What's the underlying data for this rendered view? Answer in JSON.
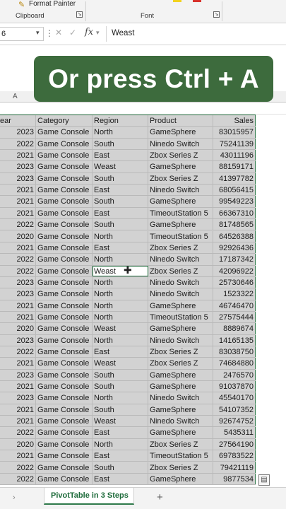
{
  "ribbon": {
    "format_painter_label": "Format Painter",
    "groups": [
      {
        "label": "Clipboard"
      },
      {
        "label": "Font"
      }
    ]
  },
  "formula_bar": {
    "namebox_value": "6",
    "fx_label": "fx",
    "value": "Weast"
  },
  "caption": "Or press Ctrl + A",
  "columns": {
    "letters": [
      "A"
    ]
  },
  "table": {
    "headers": [
      "ear",
      "Category",
      "Region",
      "Product",
      "Sales"
    ],
    "rows": [
      [
        "2023",
        "Game Console",
        "North",
        "GameSphere",
        "83015957"
      ],
      [
        "2022",
        "Game Console",
        "South",
        "Ninedo Switch",
        "75241139"
      ],
      [
        "2021",
        "Game Console",
        "East",
        "Zbox Series Z",
        "43011196"
      ],
      [
        "2023",
        "Game Console",
        "Weast",
        "GameSphere",
        "88159171"
      ],
      [
        "2023",
        "Game Console",
        "South",
        "Zbox Series Z",
        "41397782"
      ],
      [
        "2021",
        "Game Console",
        "East",
        "Ninedo Switch",
        "68056415"
      ],
      [
        "2021",
        "Game Console",
        "South",
        "GameSphere",
        "99549223"
      ],
      [
        "2021",
        "Game Console",
        "East",
        "TimeoutStation 5",
        "66367310"
      ],
      [
        "2022",
        "Game Console",
        "South",
        "GameSphere",
        "81748565"
      ],
      [
        "2020",
        "Game Console",
        "North",
        "TimeoutStation 5",
        "64526388"
      ],
      [
        "2021",
        "Game Console",
        "East",
        "Zbox Series Z",
        "92926436"
      ],
      [
        "2022",
        "Game Console",
        "North",
        "Ninedo Switch",
        "17187342"
      ],
      [
        "2022",
        "Game Console",
        "Weast",
        "Zbox Series Z",
        "42096922"
      ],
      [
        "2023",
        "Game Console",
        "North",
        "Ninedo Switch",
        "25730646"
      ],
      [
        "2023",
        "Game Console",
        "North",
        "Ninedo Switch",
        "1523322"
      ],
      [
        "2021",
        "Game Console",
        "North",
        "GameSphere",
        "46746470"
      ],
      [
        "2021",
        "Game Console",
        "North",
        "TimeoutStation 5",
        "27575444"
      ],
      [
        "2020",
        "Game Console",
        "Weast",
        "GameSphere",
        "8889674"
      ],
      [
        "2023",
        "Game Console",
        "North",
        "Ninedo Switch",
        "14165135"
      ],
      [
        "2022",
        "Game Console",
        "East",
        "Zbox Series Z",
        "83038750"
      ],
      [
        "2021",
        "Game Console",
        "Weast",
        "Zbox Series Z",
        "74684880"
      ],
      [
        "2023",
        "Game Console",
        "South",
        "GameSphere",
        "2476570"
      ],
      [
        "2021",
        "Game Console",
        "South",
        "GameSphere",
        "91037870"
      ],
      [
        "2023",
        "Game Console",
        "North",
        "Ninedo Switch",
        "45540170"
      ],
      [
        "2021",
        "Game Console",
        "South",
        "GameSphere",
        "54107352"
      ],
      [
        "2021",
        "Game Console",
        "Weast",
        "Ninedo Switch",
        "92674752"
      ],
      [
        "2022",
        "Game Console",
        "East",
        "GameSphere",
        "5435311"
      ],
      [
        "2020",
        "Game Console",
        "North",
        "Zbox Series Z",
        "27564190"
      ],
      [
        "2021",
        "Game Console",
        "East",
        "TimeoutStation 5",
        "69783522"
      ],
      [
        "2022",
        "Game Console",
        "South",
        "Zbox Series Z",
        "79421119"
      ],
      [
        "2022",
        "Game Console",
        "East",
        "GameSphere",
        "9877534"
      ]
    ],
    "active_cell": {
      "row": 12,
      "col": 2
    }
  },
  "sheet_tabs": {
    "nav_glyph": "›",
    "active_tab": "PivotTable in 3 Steps",
    "add_glyph": "+"
  },
  "icons": {
    "format_painter": "format-painter-icon",
    "cursor": "cell-select-cursor-icon",
    "quick_analysis": "quick-analysis-icon"
  },
  "colors": {
    "caption_bg": "#3d6b3d",
    "selection_border": "#2f7a4a",
    "selection_fill": "#d2d2d2"
  }
}
